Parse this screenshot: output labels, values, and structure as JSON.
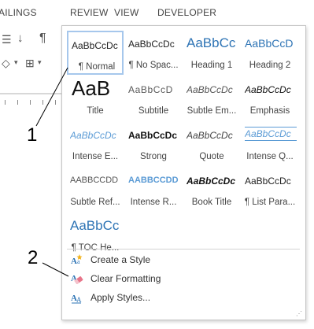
{
  "ribbon": {
    "tabs": [
      "AILINGS",
      "REVIEW",
      "VIEW",
      "DEVELOPER"
    ]
  },
  "gallery": {
    "styles": [
      {
        "preview": "AaBbCcDc",
        "name": "¶ Normal",
        "selected": true
      },
      {
        "preview": "AaBbCcDc",
        "name": "¶ No Spac..."
      },
      {
        "preview": "AaBbCc",
        "name": "Heading 1"
      },
      {
        "preview": "AaBbCcD",
        "name": "Heading 2"
      },
      {
        "preview": "AaB",
        "name": "Title"
      },
      {
        "preview": "AaBbCcD",
        "name": "Subtitle"
      },
      {
        "preview": "AaBbCcDc",
        "name": "Subtle Em..."
      },
      {
        "preview": "AaBbCcDc",
        "name": "Emphasis"
      },
      {
        "preview": "AaBbCcDc",
        "name": "Intense E..."
      },
      {
        "preview": "AaBbCcDc",
        "name": "Strong"
      },
      {
        "preview": "AaBbCcDc",
        "name": "Quote"
      },
      {
        "preview": "AaBbCcDc",
        "name": "Intense Q..."
      },
      {
        "preview": "AABBCCDD",
        "name": "Subtle Ref..."
      },
      {
        "preview": "AABBCCDD",
        "name": "Intense R..."
      },
      {
        "preview": "AaBbCcDc",
        "name": "Book Title"
      },
      {
        "preview": "AaBbCcDc",
        "name": "¶ List Para..."
      },
      {
        "preview": "AaBbCc",
        "name": "¶ TOC He..."
      }
    ],
    "commands": [
      {
        "label": "Create a Style",
        "icon": "create-style-icon"
      },
      {
        "label": "Clear Formatting",
        "icon": "clear-formatting-icon"
      },
      {
        "label": "Apply Styles...",
        "icon": "apply-styles-icon"
      }
    ]
  },
  "callouts": [
    "1",
    "2"
  ],
  "colors": {
    "selected_border": "#a6c7ec",
    "heading_blue": "#2e74b5",
    "intense_blue": "#5b9bd5"
  }
}
